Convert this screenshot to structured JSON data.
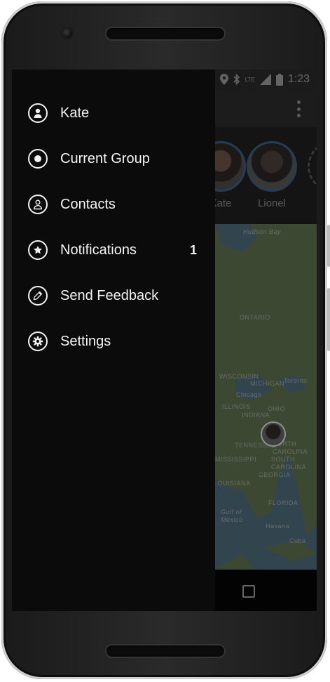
{
  "status_bar": {
    "time": "1:23",
    "lte": "LTE"
  },
  "contacts": [
    {
      "name": "Kate"
    },
    {
      "name": "Lionel"
    }
  ],
  "map": {
    "labels": {
      "hudson_bay": "Hudson Bay",
      "ontario": "ONTARIO",
      "wisconsin": "WISCONSIN",
      "michigan": "MICHIGAN",
      "toronto": "Toronto",
      "chicago": "Chicago",
      "illinois": "ILLINOIS",
      "ohio": "OHIO",
      "indiana": "INDIANA",
      "tennessee": "TENNESSEE",
      "north_carolina": "NORTH CAROLINA",
      "south_carolina": "SOUTH CAROLINA",
      "mississippi": "MISSISSIPPI",
      "georgia": "GEORGIA",
      "louisiana": "LOUISIANA",
      "florida": "FLORIDA",
      "gulf_of_mexico": "Gulf of Mexico",
      "havana": "Havana",
      "cuba": "Cuba"
    }
  },
  "drawer": {
    "items": [
      {
        "label": "Kate",
        "icon": "person-icon"
      },
      {
        "label": "Current Group",
        "icon": "radio-target-icon"
      },
      {
        "label": "Contacts",
        "icon": "contact-outline-icon"
      },
      {
        "label": "Notifications",
        "icon": "star-icon",
        "badge": "1"
      },
      {
        "label": "Send Feedback",
        "icon": "pencil-icon"
      },
      {
        "label": "Settings",
        "icon": "gear-icon"
      }
    ]
  }
}
